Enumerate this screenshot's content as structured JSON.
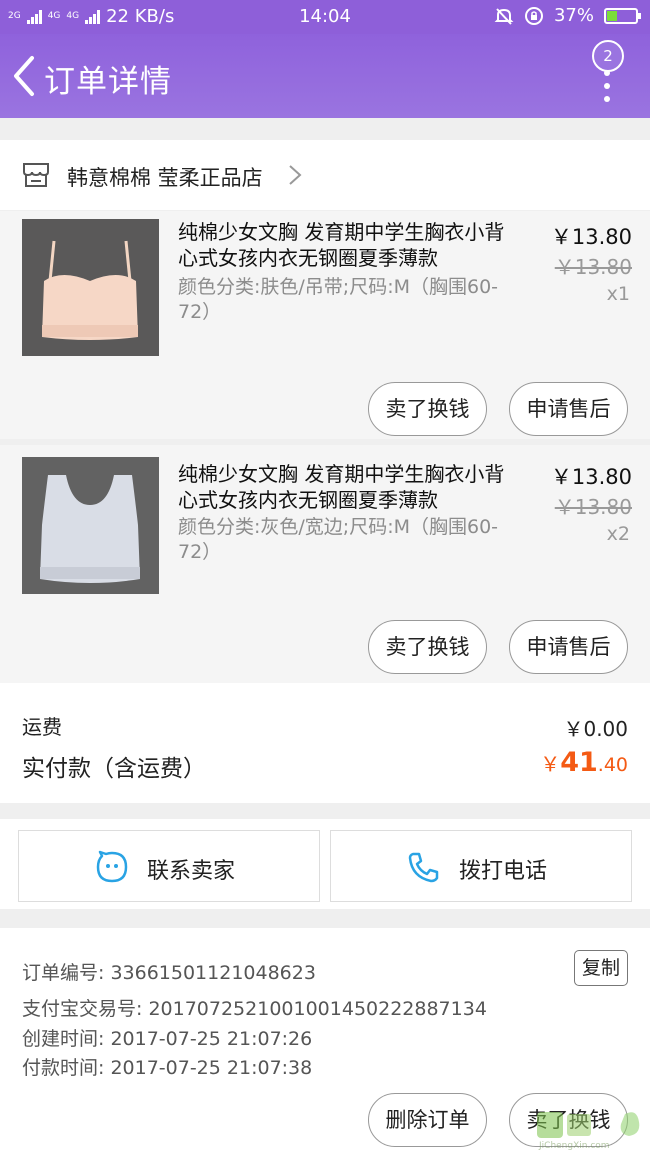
{
  "status_bar": {
    "network_types": [
      "2G",
      "4G",
      "4G"
    ],
    "speed": "22 KB/s",
    "time": "14:04",
    "battery": "37%",
    "battery_level": 0.37
  },
  "header": {
    "title": "订单详情",
    "badge_count": "2"
  },
  "shop": {
    "name": "韩意棉棉 莹柔正品店"
  },
  "items": [
    {
      "title": "纯棉少女文胸 发育期中学生胸衣小背心式女孩内衣无钢圈夏季薄款",
      "sku": "颜色分类:肤色/吊带;尺码:M（胸围60-72）",
      "price": "￥13.80",
      "original_price": "￥13.80",
      "quantity": "x1",
      "btn_sell": "卖了换钱",
      "btn_after_sale": "申请售后"
    },
    {
      "title": "纯棉少女文胸 发育期中学生胸衣小背心式女孩内衣无钢圈夏季薄款",
      "sku": "颜色分类:灰色/宽边;尺码:M（胸围60-72）",
      "price": "￥13.80",
      "original_price": "￥13.80",
      "quantity": "x2",
      "btn_sell": "卖了换钱",
      "btn_after_sale": "申请售后"
    }
  ],
  "totals": {
    "shipping_label": "运费",
    "shipping_value": "￥0.00",
    "paid_label": "实付款（含运费）",
    "paid_currency": "￥",
    "paid_integer": "41",
    "paid_decimal": ".40"
  },
  "contact": {
    "seller_label": "联系卖家",
    "phone_label": "拨打电话"
  },
  "order_info": {
    "order_no": "订单编号: 33661501121048623",
    "alipay_no": "支付宝交易号: 2017072521001001450222887134",
    "created": "创建时间: 2017-07-25 21:07:26",
    "paid": "付款时间: 2017-07-25 21:07:38",
    "copy_label": "复制"
  },
  "bottom_actions": {
    "delete_label": "删除订单",
    "sell_label": "卖了换钱"
  },
  "watermark": "JiChengXin.com",
  "colors": {
    "header": "#8f62dc",
    "accent_price": "#f45a14",
    "icon_blue": "#29a3e4"
  }
}
